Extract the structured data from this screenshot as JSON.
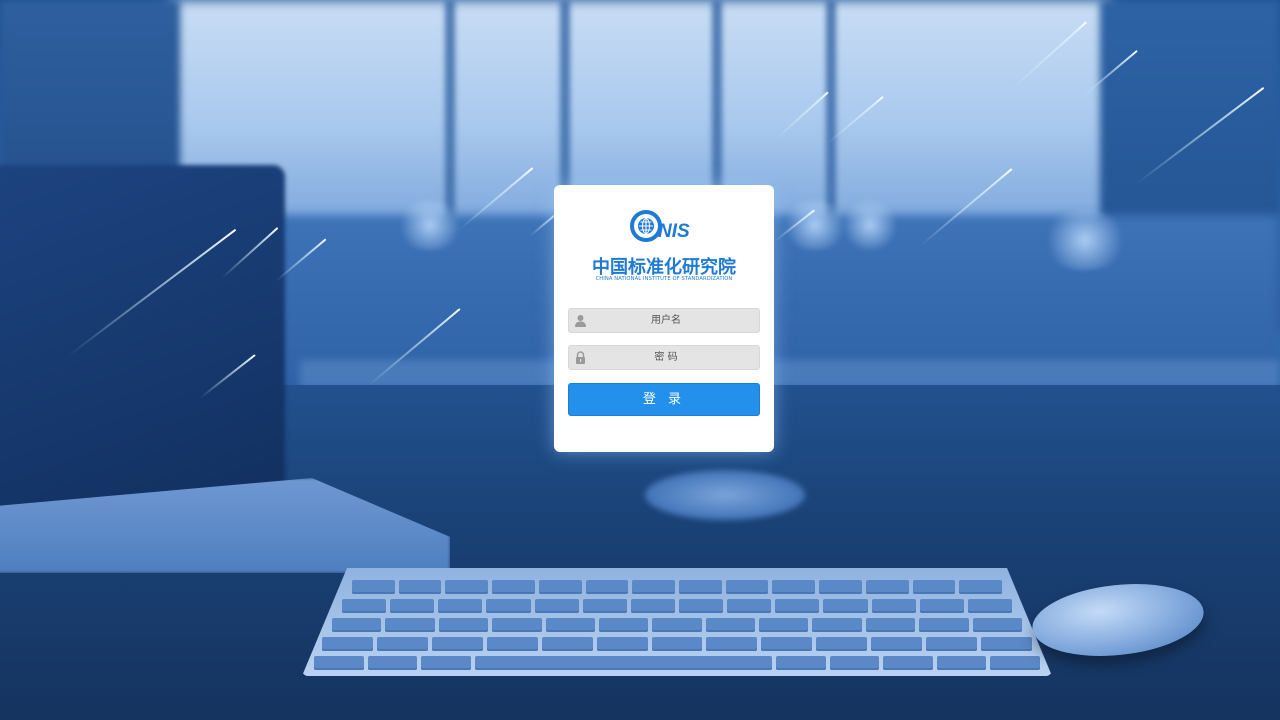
{
  "brand": {
    "logo_text": "NIS",
    "name": "中国标准化研究院",
    "name_en": "CHINA NATIONAL INSTITUTE OF STANDARDIZATION"
  },
  "login": {
    "username_placeholder": "用户名",
    "password_placeholder": "密 码",
    "submit_label": "登 录"
  },
  "colors": {
    "accent": "#2390ec",
    "brand_blue": "#1f7ad6",
    "field_bg": "#e4e4e4"
  }
}
